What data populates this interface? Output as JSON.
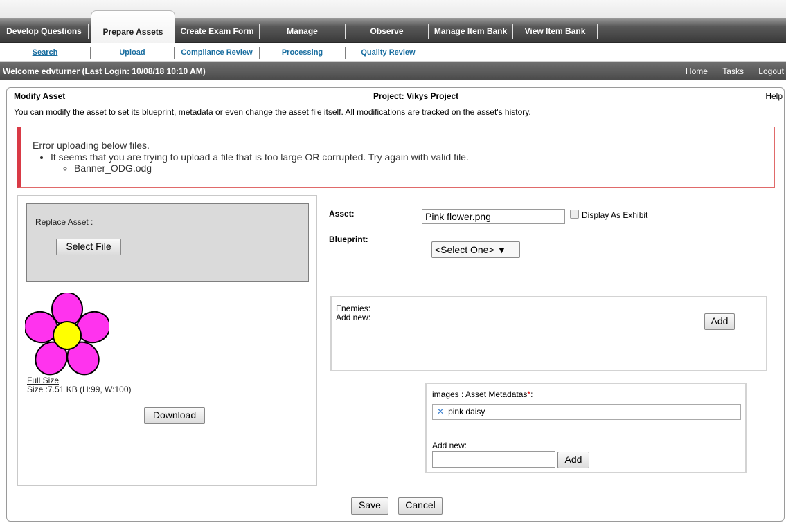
{
  "main_tabs": [
    {
      "label": "Develop Questions"
    },
    {
      "label": "Prepare Assets"
    },
    {
      "label": "Create Exam Form"
    },
    {
      "label": "Manage"
    },
    {
      "label": "Observe"
    },
    {
      "label": "Manage Item Bank"
    },
    {
      "label": "View Item Bank"
    }
  ],
  "sub_tabs": [
    {
      "label": "Search"
    },
    {
      "label": "Upload"
    },
    {
      "label": "Compliance Review"
    },
    {
      "label": "Processing"
    },
    {
      "label": "Quality Review"
    }
  ],
  "welcome": {
    "text": "Welcome edvturner (Last Login: 10/08/18   10:10 AM)",
    "links": [
      "Home",
      "Tasks",
      "Logout"
    ]
  },
  "panel": {
    "title": "Modify Asset",
    "project": "Project: Vikys Project",
    "help": "Help",
    "description": "You can modify the asset to set its blueprint, metadata or even change the asset file itself. All modifications are tracked on the asset's history."
  },
  "error": {
    "heading": "Error uploading below files.",
    "message": "It seems that you are trying to upload a file that is too large OR corrupted. Try again with valid file.",
    "file": "Banner_ODG.odg"
  },
  "replace": {
    "label": "Replace Asset :",
    "select_button": "Select File"
  },
  "preview": {
    "full_size": "Full Size",
    "size": "Size :7.51 KB (H:99, W:100)",
    "download": "Download",
    "petal_color": "#ff33ee",
    "center_color": "#ffff00"
  },
  "form": {
    "asset_label": "Asset:",
    "asset_value": "Pink flower.png",
    "display_exhibit": "Display As Exhibit",
    "blueprint_label": "Blueprint:",
    "blueprint_value": "<Select One> ▼"
  },
  "enemies": {
    "label": "Enemies:",
    "add_new": "Add new:",
    "input_value": "",
    "add_button": "Add"
  },
  "metadata": {
    "label": "images : Asset Metadatas",
    "required_mark": "*",
    "tag_suffix": ":",
    "tag": "pink daisy",
    "remove_icon": "✕",
    "add_new": "Add new:",
    "input_value": "",
    "add_button": "Add"
  },
  "actions": {
    "save": "Save",
    "cancel": "Cancel"
  }
}
